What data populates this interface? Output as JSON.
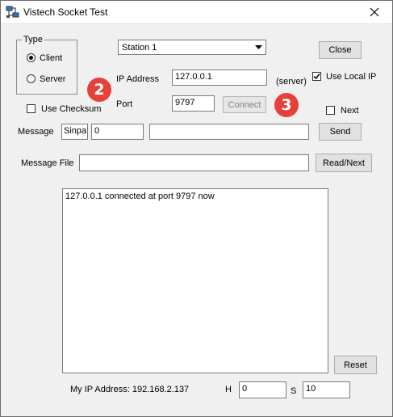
{
  "window": {
    "title": "Vistech Socket Test",
    "app_icon": "network-icon",
    "close_icon": "close-icon"
  },
  "type_group": {
    "legend": "Type",
    "options": [
      {
        "label": "Client",
        "selected": true
      },
      {
        "label": "Server",
        "selected": false
      }
    ]
  },
  "station": {
    "selected": "Station 1",
    "arrow_icon": "chevron-down-icon"
  },
  "ip": {
    "label": "IP Address",
    "value": "127.0.0.1",
    "suffix": "(server)"
  },
  "use_local_ip": {
    "label": "Use Local IP",
    "checked": true
  },
  "port": {
    "label": "Port",
    "value": "9797"
  },
  "connect_button": "Connect",
  "close_button": "Close",
  "use_checksum": {
    "label": "Use Checksum",
    "checked": false
  },
  "next": {
    "label": "Next",
    "checked": false
  },
  "message": {
    "label": "Message",
    "prefix": "Sinpa",
    "number": "0",
    "text": ""
  },
  "send_button": "Send",
  "message_file": {
    "label": "Message File",
    "value": ""
  },
  "read_next_button": "Read/Next",
  "log": {
    "lines": [
      "127.0.0.1 connected at port 9797 now"
    ]
  },
  "reset_button": "Reset",
  "status": {
    "my_ip_label": "My IP Address: 192.168.2.137"
  },
  "h_field": {
    "label": "H",
    "value": "0"
  },
  "s_field": {
    "label": "S",
    "value": "10"
  },
  "annotations": {
    "badge_2": "2",
    "badge_3": "3",
    "badge_color": "#e5413a"
  }
}
